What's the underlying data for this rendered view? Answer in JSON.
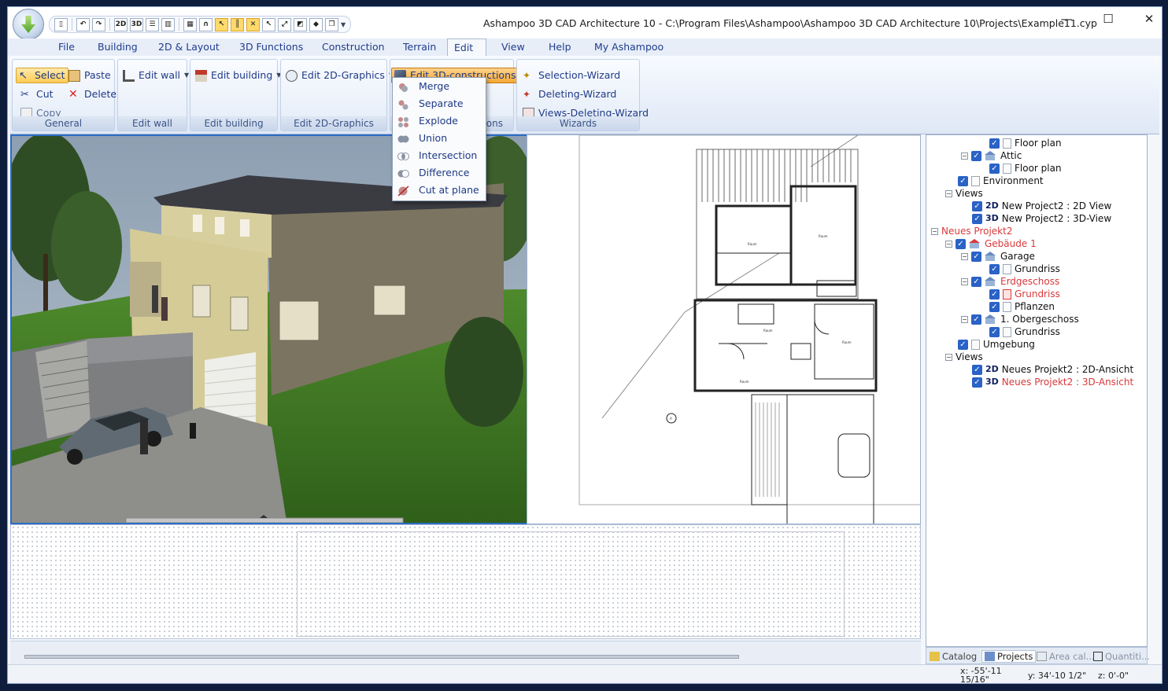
{
  "window": {
    "title": "Ashampoo 3D CAD Architecture 10 - C:\\Program Files\\Ashampoo\\Ashampoo 3D CAD Architecture 10\\Projects\\Example11.cyp",
    "minimize": "—",
    "maximize": "☐",
    "close": "✕"
  },
  "quick_access": {
    "btn_2d": "2D",
    "btn_3d": "3D"
  },
  "menu": {
    "tabs": [
      "File",
      "Building",
      "2D & Layout",
      "3D Functions",
      "Construction",
      "Terrain",
      "Edit",
      "View",
      "Help",
      "My Ashampoo"
    ],
    "active_tab": "Edit"
  },
  "ribbon": {
    "general": {
      "label": "General",
      "select": "Select",
      "paste": "Paste",
      "cut": "Cut",
      "delete": "Delete",
      "copy": "Copy"
    },
    "edit_wall": {
      "label": "Edit wall",
      "button": "Edit wall"
    },
    "edit_building": {
      "label": "Edit building",
      "button": "Edit building"
    },
    "edit_2d_graphics": {
      "label": "Edit 2D-Graphics",
      "button": "Edit 2D-Graphics"
    },
    "edit_3d": {
      "button": "Edit 3D-constructions",
      "label_partial": "ons"
    },
    "wizards": {
      "label": "Wizards",
      "selection": "Selection-Wizard",
      "deleting": "Deleting-Wizard",
      "views_deleting": "Views-Deleting-Wizard"
    }
  },
  "dropdown": {
    "items": [
      "Merge",
      "Separate",
      "Explode",
      "Union",
      "Intersection",
      "Difference",
      "Cut at plane"
    ]
  },
  "plan_labels": {
    "raum": "Raum",
    "marker": "A"
  },
  "tree": {
    "rows": [
      {
        "text": "Floor plan"
      },
      {
        "text": "Attic"
      },
      {
        "text": "Floor plan"
      },
      {
        "text": "Environment"
      },
      {
        "text": "Views"
      },
      {
        "badge": "2D",
        "text": "New Project2 : 2D View"
      },
      {
        "badge": "3D",
        "text": "New Project2 : 3D-View"
      },
      {
        "text": "Neues Projekt2"
      },
      {
        "text": "Gebäude 1"
      },
      {
        "text": "Garage"
      },
      {
        "text": "Grundriss"
      },
      {
        "text": "Erdgeschoss"
      },
      {
        "text": "Grundriss"
      },
      {
        "text": "Pflanzen"
      },
      {
        "text": "1. Obergeschoss"
      },
      {
        "text": "Grundriss"
      },
      {
        "text": "Umgebung"
      },
      {
        "text": "Views"
      },
      {
        "badge": "2D",
        "text": "Neues Projekt2 : 2D-Ansicht"
      },
      {
        "badge": "3D",
        "text": "Neues Projekt2 : 3D-Ansicht"
      }
    ]
  },
  "panel_tabs": {
    "catalog": "Catalog",
    "projects": "Projects",
    "area": "Area cal...",
    "quantities": "Quantiti..."
  },
  "status": {
    "x_line1": "x: -55'-11",
    "x_line2": "15/16\"",
    "y": "y: 34'-10 1/2\"",
    "z": "z: 0'-0\""
  },
  "colors": {
    "accent": "#2b6cc4",
    "highlight": "#ffcc55",
    "tree_red": "#d8393b"
  }
}
